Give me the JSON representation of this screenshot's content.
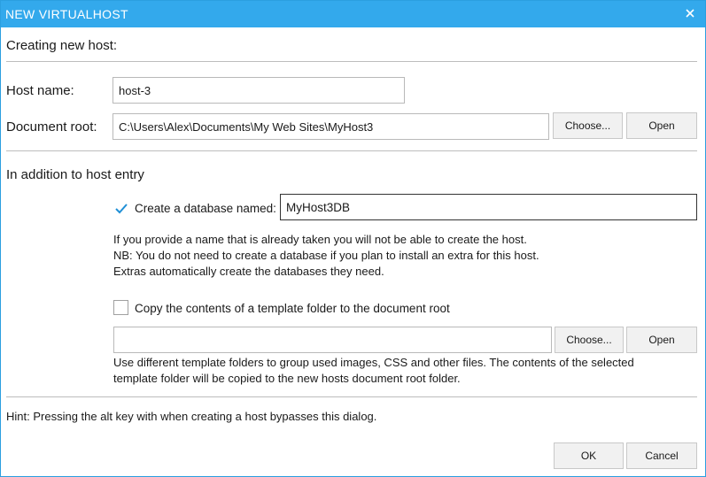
{
  "window": {
    "title": "NEW VIRTUALHOST",
    "close_icon": "close-icon"
  },
  "colors": {
    "titlebar": "#33a9ec",
    "checkmark": "#1f8fd6"
  },
  "creating": {
    "heading": "Creating new host:",
    "host_name_label": "Host name:",
    "host_name_value": "host-3",
    "doc_root_label": "Document root:",
    "doc_root_value": "C:\\Users\\Alex\\Documents\\My Web Sites\\MyHost3",
    "choose_label": "Choose...",
    "open_label": "Open"
  },
  "addition": {
    "heading": "In addition to host entry",
    "create_db_label": "Create a database named:",
    "create_db_checked": true,
    "db_name_value": "MyHost3DB",
    "db_note_lines": [
      "If you provide a name that is already taken you will not be able to create the host.",
      "NB: You do not need to create a database if you plan to install an extra for this host.",
      "Extras automatically create the databases they need."
    ],
    "template_label": "Copy the contents of a template folder to the document root",
    "template_checked": false,
    "template_value": "",
    "choose_label": "Choose...",
    "open_label": "Open",
    "template_note_lines": [
      "Use different template folders to group used images, CSS and other files. The contents of the selected",
      "template folder will be copied to the new hosts document root folder."
    ]
  },
  "hint": "Hint: Pressing the alt key with when creating a host bypasses this dialog.",
  "footer": {
    "ok_label": "OK",
    "cancel_label": "Cancel"
  }
}
